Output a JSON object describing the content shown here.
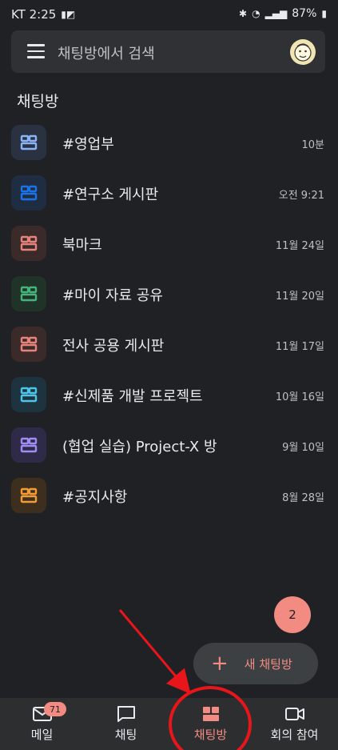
{
  "status_bar": {
    "time": "KT 2:25",
    "battery": "87%"
  },
  "search": {
    "placeholder": "채팅방에서 검색"
  },
  "section_title": "채팅방",
  "rooms": [
    {
      "name": "#영업부",
      "time": "10분",
      "color": "#8ab4f8",
      "bg": "#2a3140"
    },
    {
      "name": "#연구소 게시판",
      "time": "오전 9:21",
      "color": "#1a73e8",
      "bg": "#1f2d42"
    },
    {
      "name": "북마크",
      "time": "11월 24일",
      "color": "#e8837a",
      "bg": "#3b2a2a"
    },
    {
      "name": "#마이 자료 공유",
      "time": "11월 20일",
      "color": "#46b47a",
      "bg": "#1f3328"
    },
    {
      "name": "전사 공용 게시판",
      "time": "11월 17일",
      "color": "#e8837a",
      "bg": "#3b2a2a"
    },
    {
      "name": "#신제품 개발 프로젝트",
      "time": "10월 16일",
      "color": "#4ec4e6",
      "bg": "#1d3440"
    },
    {
      "name": "(협업 실습) Project-X 방",
      "time": "9월 10일",
      "color": "#a28cf5",
      "bg": "#2e2a48"
    },
    {
      "name": "#공지사항",
      "time": "8월 28일",
      "color": "#f29c38",
      "bg": "#3e2e1e"
    }
  ],
  "step_badge": "2",
  "fab": {
    "label": "새 채팅방"
  },
  "nav": {
    "mail": "메일",
    "mail_badge": "71",
    "chat": "채팅",
    "rooms": "채팅방",
    "meeting": "회의 참여"
  },
  "colors": {
    "accent": "#f28b82",
    "background": "#202124",
    "annotation": "#e8151b"
  }
}
